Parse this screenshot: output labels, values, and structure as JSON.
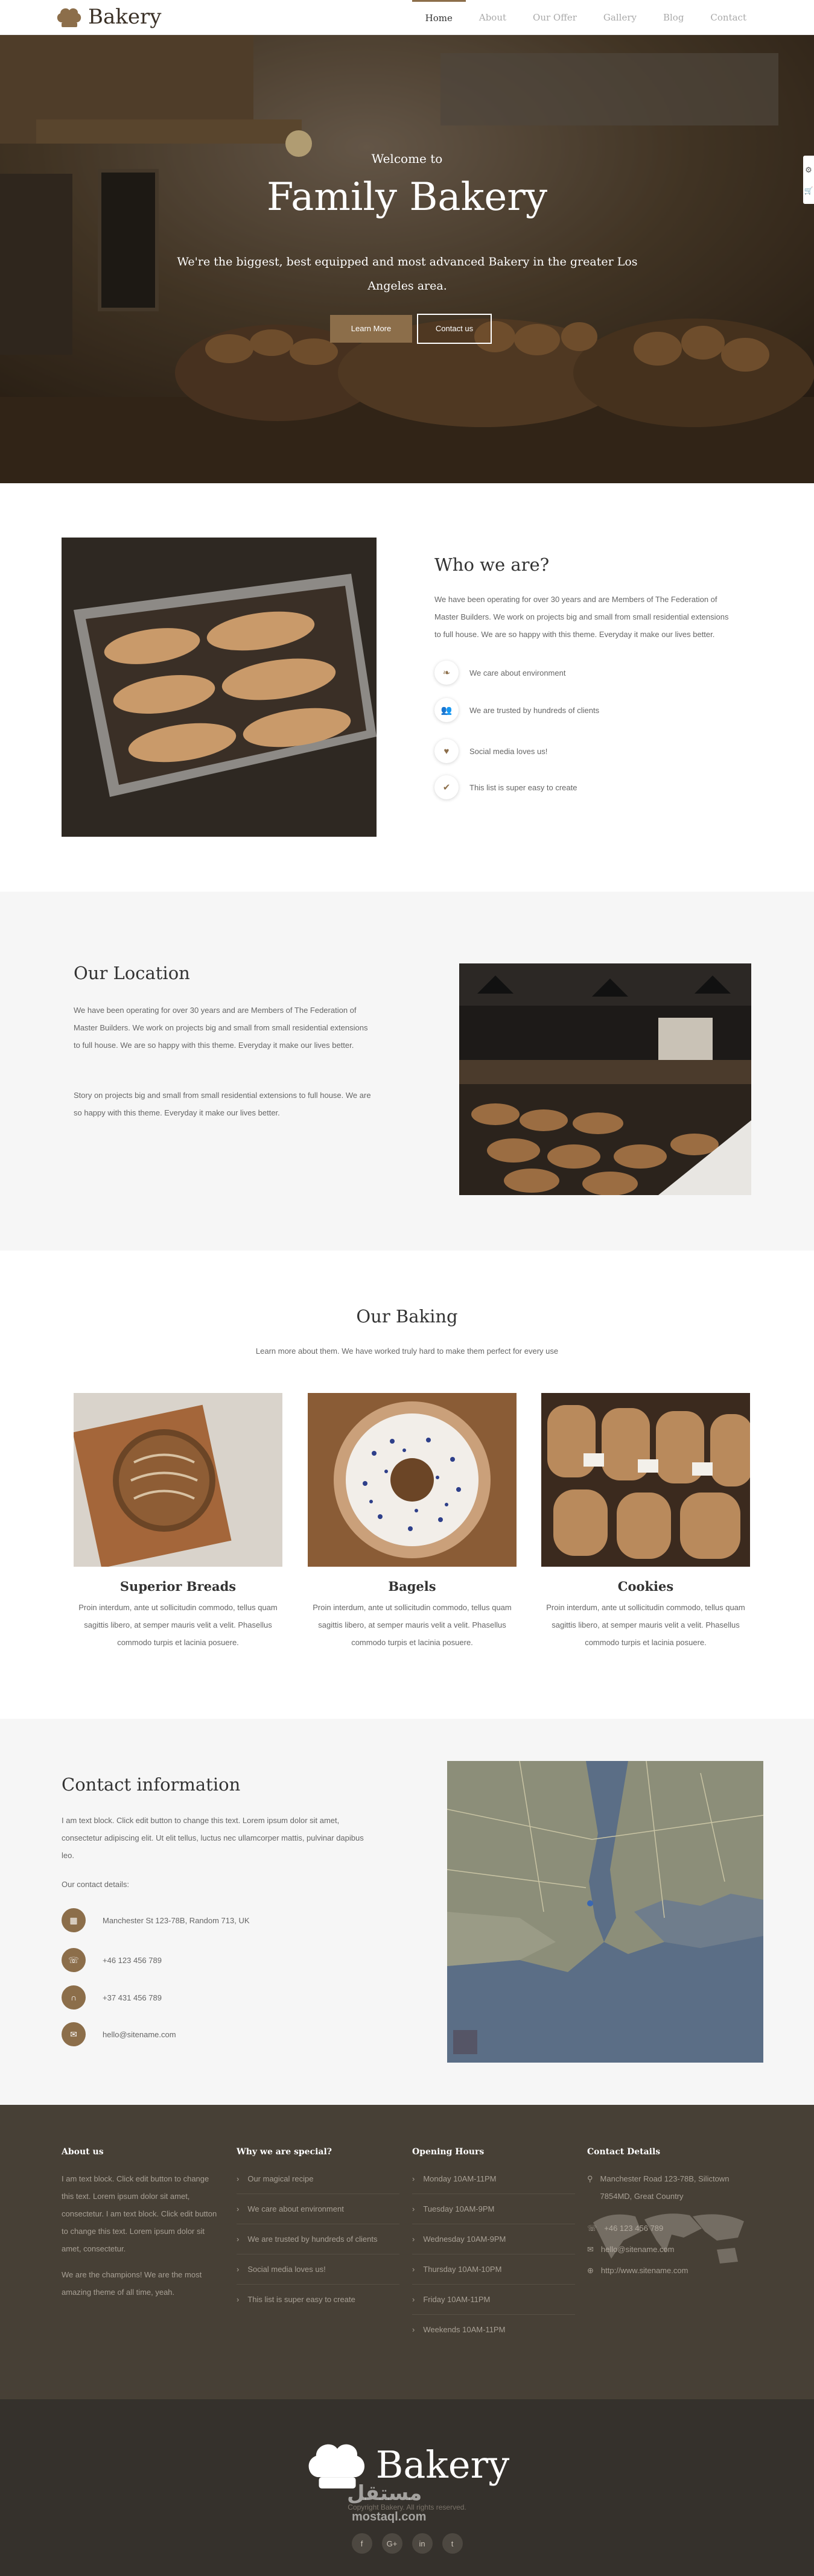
{
  "header": {
    "logo_text": "Bakery",
    "nav": [
      "Home",
      "About",
      "Our Offer",
      "Gallery",
      "Blog",
      "Contact"
    ],
    "active": "Home"
  },
  "hero": {
    "welcome": "Welcome to",
    "title": "Family Bakery",
    "subtitle": "We're the biggest, best equipped and most advanced Bakery in the greater Los Angeles area.",
    "btn_primary": "Learn More",
    "btn_secondary": "Contact us"
  },
  "who": {
    "title": "Who we are?",
    "text": "We have been operating for over 30 years and are Members of The Federation of Master Builders. We work on projects big and small from small residential extensions to full house. We are so happy with this theme. Everyday it make our lives better.",
    "features": [
      {
        "icon": "leaf-icon",
        "text": "We care about environment"
      },
      {
        "icon": "users-icon",
        "text": "We are trusted by hundreds of clients"
      },
      {
        "icon": "heart-icon",
        "text": "Social media loves us!"
      },
      {
        "icon": "check-icon",
        "text": "This list is super easy to create"
      }
    ]
  },
  "location": {
    "title": "Our Location",
    "p1": "We have been operating for over 30 years and are Members of The Federation of Master Builders. We work on projects big and small from small residential extensions to full house. We are so happy with this theme. Everyday it make our lives better.",
    "p2": "Story on projects big and small from small residential extensions to full house. We are so happy with this theme. Everyday it make our lives better."
  },
  "baking": {
    "title": "Our Baking",
    "subtitle": "Learn more about them. We have worked truly hard to make them perfect for every use",
    "items": [
      {
        "name": "Superior Breads",
        "text": "Proin interdum, ante ut sollicitudin commodo, tellus quam sagittis libero, at semper mauris velit a velit. Phasellus commodo turpis et lacinia posuere."
      },
      {
        "name": "Bagels",
        "text": "Proin interdum, ante ut sollicitudin commodo, tellus quam sagittis libero, at semper mauris velit a velit. Phasellus commodo turpis et lacinia posuere."
      },
      {
        "name": "Cookies",
        "text": "Proin interdum, ante ut sollicitudin commodo, tellus quam sagittis libero, at semper mauris velit a velit. Phasellus commodo turpis et lacinia posuere."
      }
    ]
  },
  "contact": {
    "title": "Contact information",
    "text": "I am text block. Click edit button to change this text. Lorem ipsum dolor sit amet, consectetur adipiscing elit. Ut elit tellus, luctus nec ullamcorper mattis, pulvinar dapibus leo.",
    "details_label": "Our contact details:",
    "items": [
      {
        "icon": "map-icon",
        "text": "Manchester St 123-78B, Random 713, UK"
      },
      {
        "icon": "phone-icon",
        "text": "+46 123 456 789"
      },
      {
        "icon": "headset-icon",
        "text": "+37 431 456 789"
      },
      {
        "icon": "mail-icon",
        "text": "hello@sitename.com"
      }
    ]
  },
  "footer": {
    "about_title": "About us",
    "about_p1": "I am text block. Click edit button to change this text. Lorem ipsum dolor sit amet, consectetur. I am text block. Click edit button to change this text. Lorem ipsum dolor sit amet, consectetur.",
    "about_p2": "We are the champions! We are the most amazing theme of all time, yeah.",
    "special_title": "Why we are special?",
    "special_items": [
      "Our magical recipe",
      "We care about environment",
      "We are trusted by hundreds of clients",
      "Social media loves us!",
      "This list is super easy to create"
    ],
    "hours_title": "Opening Hours",
    "hours_items": [
      "Monday 10AM-11PM",
      "Tuesday 10AM-9PM",
      "Wednesday 10AM-9PM",
      "Thursday 10AM-10PM",
      "Friday 10AM-11PM",
      "Weekends 10AM-11PM"
    ],
    "cd_title": "Contact Details",
    "cd_address": "Manchester Road 123-78B, Silictown 7854MD, Great Country",
    "cd_phone": "+46 123 456 789",
    "cd_email": "hello@sitename.com",
    "cd_web": "http://www.sitename.com"
  },
  "bottom": {
    "logo_text": "Bakery",
    "copyright": "Copyright Bakery. All rights reserved.",
    "watermark": "مستقل",
    "watermark_sub": "mostaql.com",
    "social": [
      "f",
      "G+",
      "in",
      "t"
    ]
  },
  "colors": {
    "accent": "#8c6e4a",
    "dark_footer": "#474036",
    "bottom_bar": "#35312c",
    "light_bg": "#f6f6f6"
  }
}
